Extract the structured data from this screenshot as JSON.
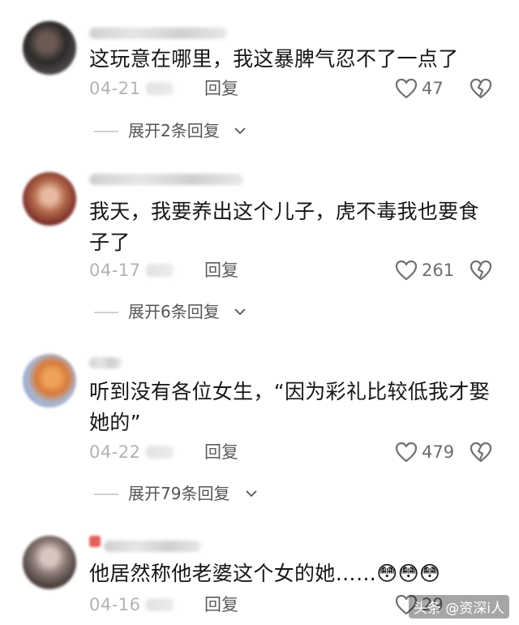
{
  "comments": [
    {
      "text": "这玩意在哪里，我这暴脾气忍不了一点了",
      "date": "04-21",
      "reply_label": "回复",
      "likes": "47",
      "expand_label": "展开2条回复"
    },
    {
      "text": "我天，我要养出这个儿子，虎不毒我也要食子了",
      "date": "04-17",
      "reply_label": "回复",
      "likes": "261",
      "expand_label": "展开6条回复"
    },
    {
      "text": "听到没有各位女生，“因为彩礼比较低我才娶她的”",
      "date": "04-22",
      "reply_label": "回复",
      "likes": "479",
      "expand_label": "展开79条回复"
    },
    {
      "text": "他居然称他老婆这个女的她……😳😳😳",
      "date": "04-16",
      "reply_label": "回复",
      "likes": "29"
    }
  ],
  "icons": {
    "like": "heart-outline-icon",
    "dislike": "broken-heart-icon",
    "expand": "chevron-down-icon"
  },
  "watermark": "头条 @资深i人"
}
